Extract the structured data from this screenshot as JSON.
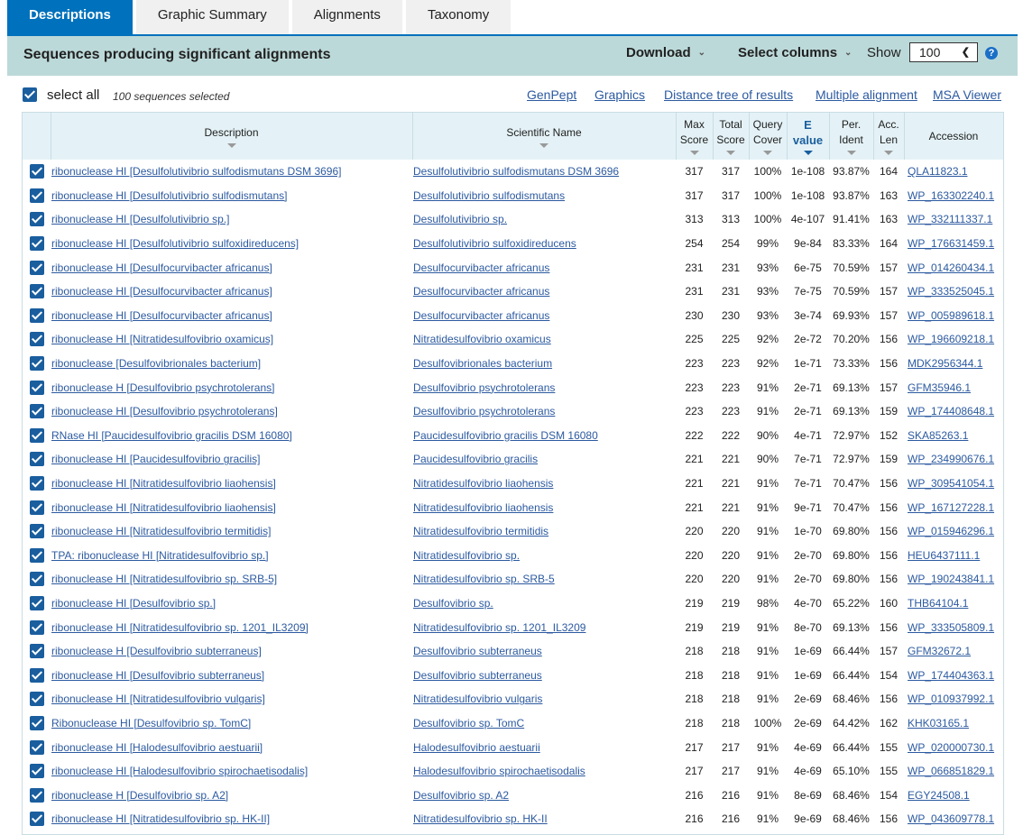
{
  "tabs": [
    "Descriptions",
    "Graphic Summary",
    "Alignments",
    "Taxonomy"
  ],
  "header": {
    "title": "Sequences producing significant alignments",
    "download": "Download",
    "select_columns": "Select columns",
    "show_label": "Show",
    "show_value": "100",
    "help": "?"
  },
  "toolbar": {
    "select_all": "select all",
    "selected_count": "100 sequences selected",
    "links": [
      "GenPept",
      "Graphics",
      "Distance tree of results",
      "Multiple alignment",
      "MSA Viewer"
    ]
  },
  "columns": {
    "description": "Description",
    "scientific_name": "Scientific Name",
    "max_score": [
      "Max",
      "Score"
    ],
    "total_score": [
      "Total",
      "Score"
    ],
    "query_cover": [
      "Query",
      "Cover"
    ],
    "e_value": [
      "E",
      "value"
    ],
    "per_ident": [
      "Per.",
      "Ident"
    ],
    "acc_len": [
      "Acc.",
      "Len"
    ],
    "accession": "Accession"
  },
  "rows": [
    {
      "desc": "ribonuclease HI [Desulfolutivibrio sulfodismutans DSM 3696]",
      "sci": "Desulfolutivibrio sulfodismutans DSM 3696",
      "max": "317",
      "total": "317",
      "cover": "100%",
      "e": "1e-108",
      "ident": "93.87%",
      "len": "164",
      "acc": "QLA11823.1"
    },
    {
      "desc": "ribonuclease HI [Desulfolutivibrio sulfodismutans]",
      "sci": "Desulfolutivibrio sulfodismutans",
      "max": "317",
      "total": "317",
      "cover": "100%",
      "e": "1e-108",
      "ident": "93.87%",
      "len": "163",
      "acc": "WP_163302240.1"
    },
    {
      "desc": "ribonuclease HI [Desulfolutivibrio sp.]",
      "sci": "Desulfolutivibrio sp.",
      "max": "313",
      "total": "313",
      "cover": "100%",
      "e": "4e-107",
      "ident": "91.41%",
      "len": "163",
      "acc": "WP_332111337.1"
    },
    {
      "desc": "ribonuclease HI [Desulfolutivibrio sulfoxidireducens]",
      "sci": "Desulfolutivibrio sulfoxidireducens",
      "max": "254",
      "total": "254",
      "cover": "99%",
      "e": "9e-84",
      "ident": "83.33%",
      "len": "164",
      "acc": "WP_176631459.1"
    },
    {
      "desc": "ribonuclease HI [Desulfocurvibacter africanus]",
      "sci": "Desulfocurvibacter africanus",
      "max": "231",
      "total": "231",
      "cover": "93%",
      "e": "6e-75",
      "ident": "70.59%",
      "len": "157",
      "acc": "WP_014260434.1"
    },
    {
      "desc": "ribonuclease HI [Desulfocurvibacter africanus]",
      "sci": "Desulfocurvibacter africanus",
      "max": "231",
      "total": "231",
      "cover": "93%",
      "e": "7e-75",
      "ident": "70.59%",
      "len": "157",
      "acc": "WP_333525045.1"
    },
    {
      "desc": "ribonuclease HI [Desulfocurvibacter africanus]",
      "sci": "Desulfocurvibacter africanus",
      "max": "230",
      "total": "230",
      "cover": "93%",
      "e": "3e-74",
      "ident": "69.93%",
      "len": "157",
      "acc": "WP_005989618.1"
    },
    {
      "desc": "ribonuclease HI [Nitratidesulfovibrio oxamicus]",
      "sci": "Nitratidesulfovibrio oxamicus",
      "max": "225",
      "total": "225",
      "cover": "92%",
      "e": "2e-72",
      "ident": "70.20%",
      "len": "156",
      "acc": "WP_196609218.1"
    },
    {
      "desc": "ribonuclease [Desulfovibrionales bacterium]",
      "sci": "Desulfovibrionales bacterium",
      "max": "223",
      "total": "223",
      "cover": "92%",
      "e": "1e-71",
      "ident": "73.33%",
      "len": "156",
      "acc": "MDK2956344.1"
    },
    {
      "desc": "ribonuclease H [Desulfovibrio psychrotolerans]",
      "sci": "Desulfovibrio psychrotolerans",
      "max": "223",
      "total": "223",
      "cover": "91%",
      "e": "2e-71",
      "ident": "69.13%",
      "len": "157",
      "acc": "GFM35946.1"
    },
    {
      "desc": "ribonuclease HI [Desulfovibrio psychrotolerans]",
      "sci": "Desulfovibrio psychrotolerans",
      "max": "223",
      "total": "223",
      "cover": "91%",
      "e": "2e-71",
      "ident": "69.13%",
      "len": "159",
      "acc": "WP_174408648.1"
    },
    {
      "desc": "RNase HI [Paucidesulfovibrio gracilis DSM 16080]",
      "sci": "Paucidesulfovibrio gracilis DSM 16080",
      "max": "222",
      "total": "222",
      "cover": "90%",
      "e": "4e-71",
      "ident": "72.97%",
      "len": "152",
      "acc": "SKA85263.1"
    },
    {
      "desc": "ribonuclease HI [Paucidesulfovibrio gracilis]",
      "sci": "Paucidesulfovibrio gracilis",
      "max": "221",
      "total": "221",
      "cover": "90%",
      "e": "7e-71",
      "ident": "72.97%",
      "len": "159",
      "acc": "WP_234990676.1"
    },
    {
      "desc": "ribonuclease HI [Nitratidesulfovibrio liaohensis]",
      "sci": "Nitratidesulfovibrio liaohensis",
      "max": "221",
      "total": "221",
      "cover": "91%",
      "e": "7e-71",
      "ident": "70.47%",
      "len": "156",
      "acc": "WP_309541054.1"
    },
    {
      "desc": "ribonuclease HI [Nitratidesulfovibrio liaohensis]",
      "sci": "Nitratidesulfovibrio liaohensis",
      "max": "221",
      "total": "221",
      "cover": "91%",
      "e": "9e-71",
      "ident": "70.47%",
      "len": "156",
      "acc": "WP_167127228.1"
    },
    {
      "desc": "ribonuclease HI [Nitratidesulfovibrio termitidis]",
      "sci": "Nitratidesulfovibrio termitidis",
      "max": "220",
      "total": "220",
      "cover": "91%",
      "e": "1e-70",
      "ident": "69.80%",
      "len": "156",
      "acc": "WP_015946296.1"
    },
    {
      "desc": "TPA: ribonuclease HI [Nitratidesulfovibrio sp.]",
      "sci": "Nitratidesulfovibrio sp.",
      "max": "220",
      "total": "220",
      "cover": "91%",
      "e": "2e-70",
      "ident": "69.80%",
      "len": "156",
      "acc": "HEU6437111.1"
    },
    {
      "desc": "ribonuclease HI [Nitratidesulfovibrio sp. SRB-5]",
      "sci": "Nitratidesulfovibrio sp. SRB-5",
      "max": "220",
      "total": "220",
      "cover": "91%",
      "e": "2e-70",
      "ident": "69.80%",
      "len": "156",
      "acc": "WP_190243841.1"
    },
    {
      "desc": "ribonuclease HI [Desulfovibrio sp.]",
      "sci": "Desulfovibrio sp.",
      "max": "219",
      "total": "219",
      "cover": "98%",
      "e": "4e-70",
      "ident": "65.22%",
      "len": "160",
      "acc": "THB64104.1"
    },
    {
      "desc": "ribonuclease HI [Nitratidesulfovibrio sp. 1201_IL3209]",
      "sci": "Nitratidesulfovibrio sp. 1201_IL3209",
      "max": "219",
      "total": "219",
      "cover": "91%",
      "e": "8e-70",
      "ident": "69.13%",
      "len": "156",
      "acc": "WP_333505809.1"
    },
    {
      "desc": "ribonuclease H [Desulfovibrio subterraneus]",
      "sci": "Desulfovibrio subterraneus",
      "max": "218",
      "total": "218",
      "cover": "91%",
      "e": "1e-69",
      "ident": "66.44%",
      "len": "157",
      "acc": "GFM32672.1"
    },
    {
      "desc": "ribonuclease HI [Desulfovibrio subterraneus]",
      "sci": "Desulfovibrio subterraneus",
      "max": "218",
      "total": "218",
      "cover": "91%",
      "e": "1e-69",
      "ident": "66.44%",
      "len": "154",
      "acc": "WP_174404363.1"
    },
    {
      "desc": "ribonuclease HI [Nitratidesulfovibrio vulgaris]",
      "sci": "Nitratidesulfovibrio vulgaris",
      "max": "218",
      "total": "218",
      "cover": "91%",
      "e": "2e-69",
      "ident": "68.46%",
      "len": "156",
      "acc": "WP_010937992.1"
    },
    {
      "desc": "Ribonuclease HI [Desulfovibrio sp. TomC]",
      "sci": "Desulfovibrio sp. TomC",
      "max": "218",
      "total": "218",
      "cover": "100%",
      "e": "2e-69",
      "ident": "64.42%",
      "len": "162",
      "acc": "KHK03165.1"
    },
    {
      "desc": "ribonuclease HI [Halodesulfovibrio aestuarii]",
      "sci": "Halodesulfovibrio aestuarii",
      "max": "217",
      "total": "217",
      "cover": "91%",
      "e": "4e-69",
      "ident": "66.44%",
      "len": "155",
      "acc": "WP_020000730.1"
    },
    {
      "desc": "ribonuclease HI [Halodesulfovibrio spirochaetisodalis]",
      "sci": "Halodesulfovibrio spirochaetisodalis",
      "max": "217",
      "total": "217",
      "cover": "91%",
      "e": "4e-69",
      "ident": "65.10%",
      "len": "155",
      "acc": "WP_066851829.1"
    },
    {
      "desc": "ribonuclease H [Desulfovibrio sp. A2]",
      "sci": "Desulfovibrio sp. A2",
      "max": "216",
      "total": "216",
      "cover": "91%",
      "e": "8e-69",
      "ident": "68.46%",
      "len": "154",
      "acc": "EGY24508.1"
    },
    {
      "desc": "ribonuclease HI [Nitratidesulfovibrio sp. HK-II]",
      "sci": "Nitratidesulfovibrio sp. HK-II",
      "max": "216",
      "total": "216",
      "cover": "91%",
      "e": "9e-69",
      "ident": "68.46%",
      "len": "156",
      "acc": "WP_043609778.1"
    }
  ]
}
